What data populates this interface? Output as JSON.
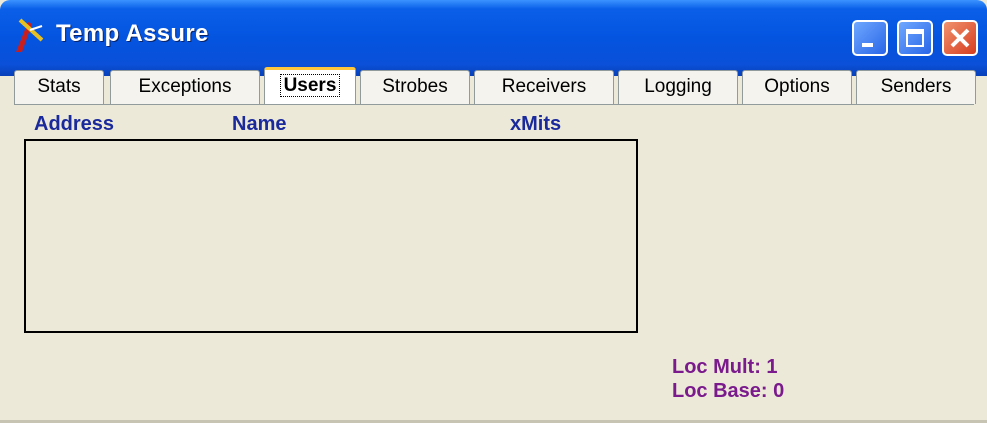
{
  "window": {
    "title": "Temp Assure",
    "controls": {
      "minimize": "minimize",
      "maximize": "maximize",
      "close": "close"
    }
  },
  "tabs": [
    {
      "label": "Stats",
      "active": false
    },
    {
      "label": "Exceptions",
      "active": false
    },
    {
      "label": "Users",
      "active": true
    },
    {
      "label": "Strobes",
      "active": false
    },
    {
      "label": "Receivers",
      "active": false
    },
    {
      "label": "Logging",
      "active": false
    },
    {
      "label": "Options",
      "active": false
    },
    {
      "label": "Senders",
      "active": false
    }
  ],
  "users_panel": {
    "columns": [
      "Address",
      "Name",
      "xMits"
    ],
    "rows": []
  },
  "status": {
    "loc_mult": "Loc Mult: 1",
    "loc_base": "Loc Base: 0"
  },
  "colors": {
    "titlebar": "#0454e0",
    "column_header": "#1a2a9c",
    "status_text": "#7a1a8c",
    "window_bg": "#ece9d8"
  }
}
